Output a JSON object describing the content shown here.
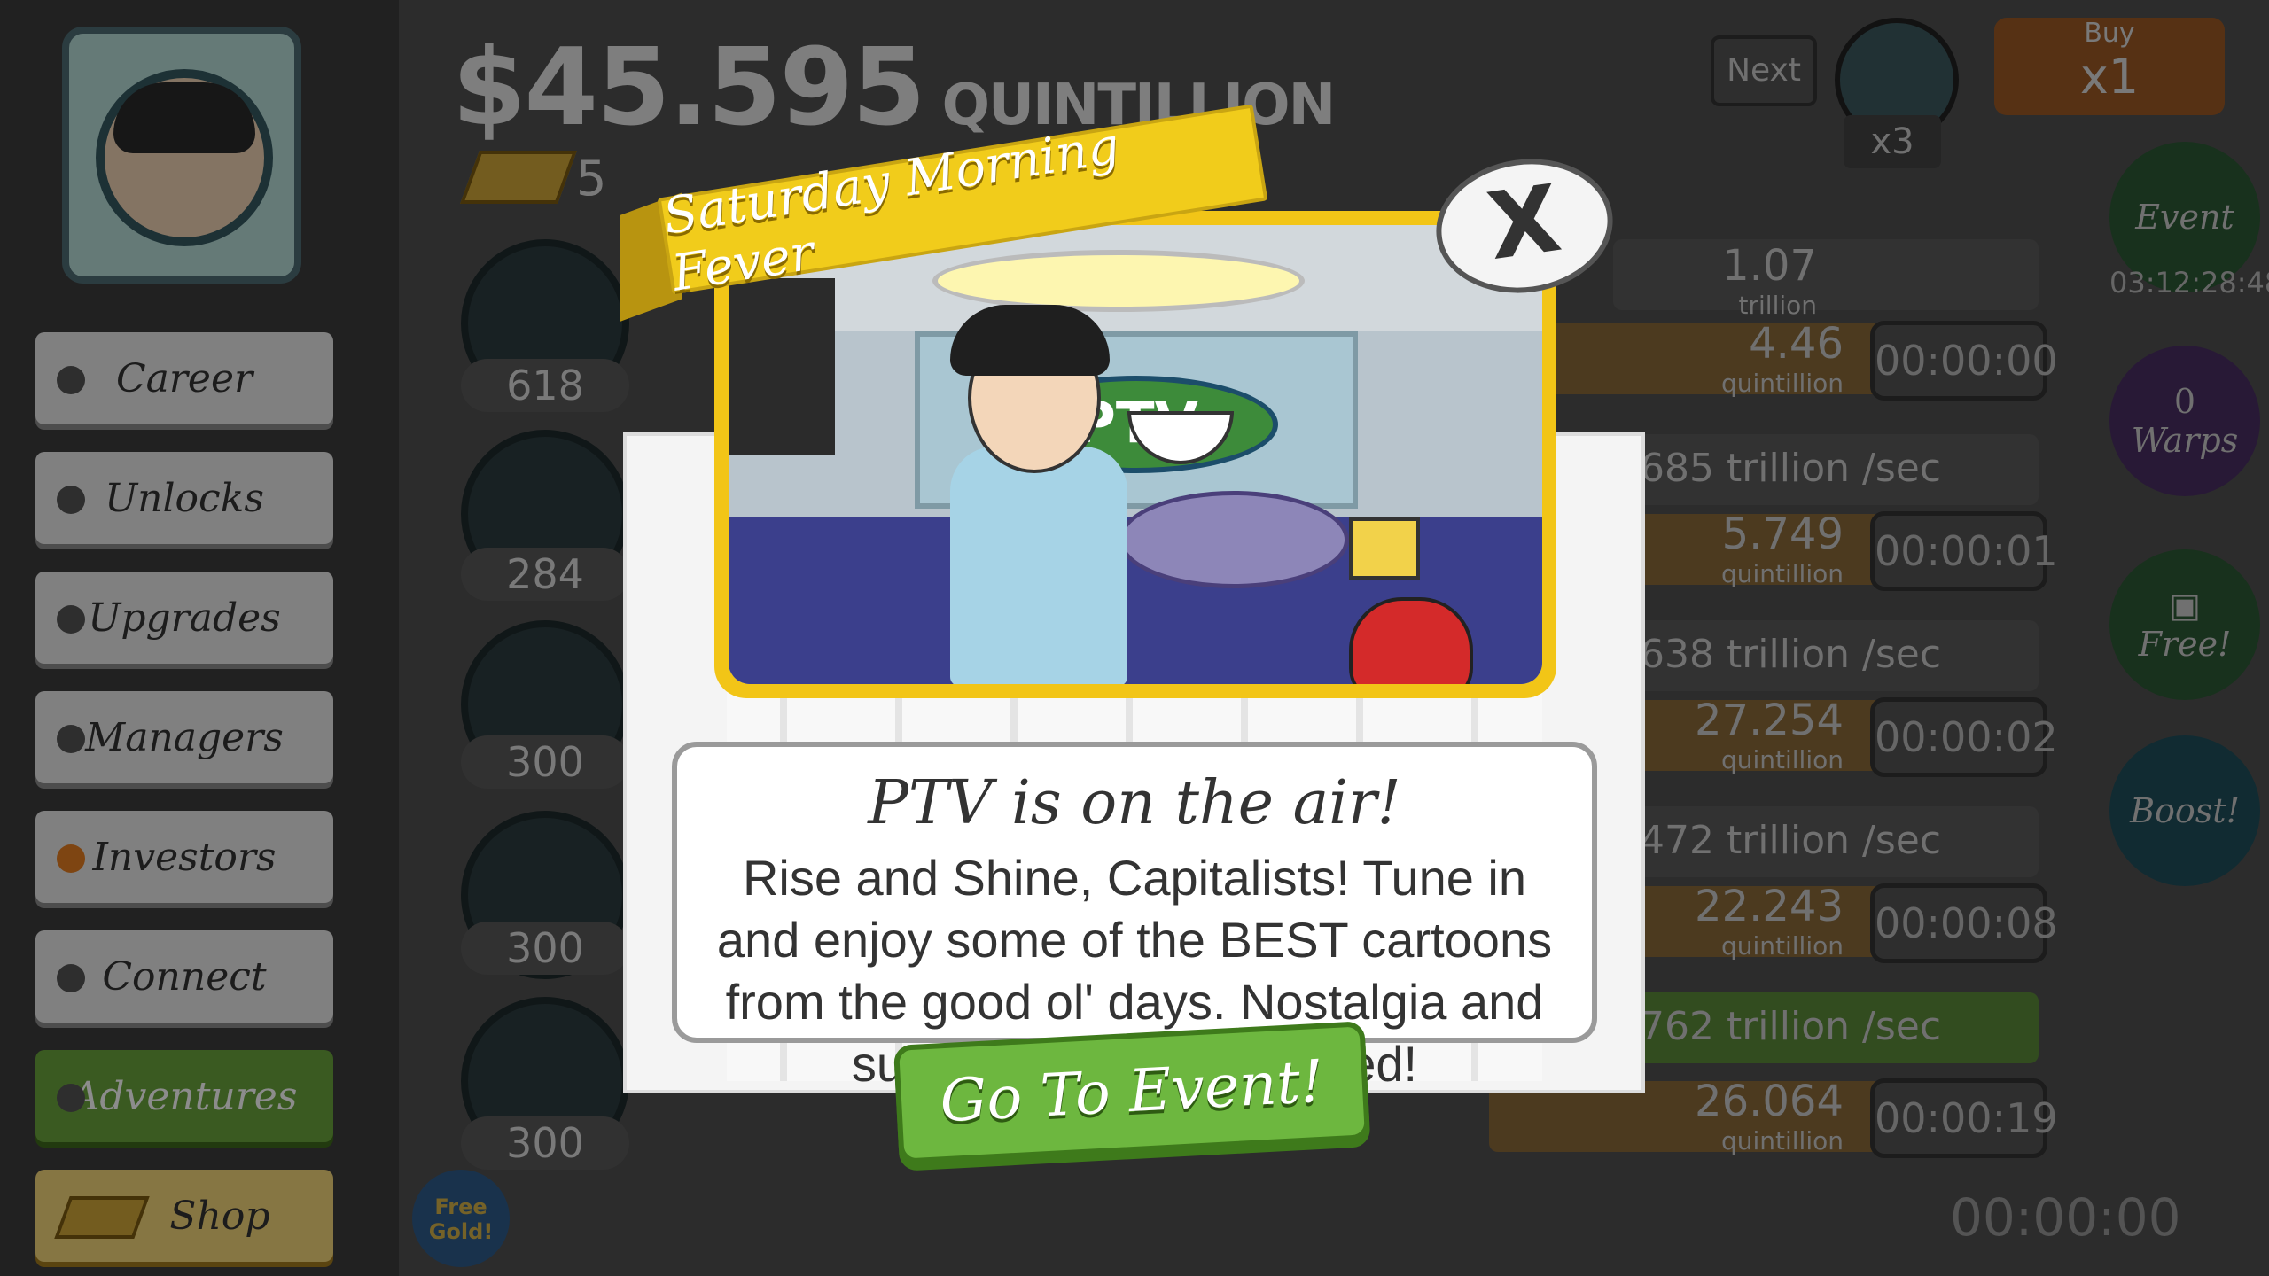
{
  "header": {
    "money_symbol": "$",
    "money_amount": "45.595",
    "money_unit": "QUINTILLION",
    "gold_count": "5",
    "next_label": "Next",
    "multiplier": "x3",
    "buy_label": "Buy",
    "buy_amount": "x1"
  },
  "sidebar": {
    "items": [
      {
        "label": "Career"
      },
      {
        "label": "Unlocks"
      },
      {
        "label": "Upgrades"
      },
      {
        "label": "Managers"
      },
      {
        "label": "Investors"
      },
      {
        "label": "Connect"
      },
      {
        "label": "Adventures"
      },
      {
        "label": "Shop"
      }
    ],
    "free_gold": "Free Gold!"
  },
  "businesses": [
    {
      "count": "618",
      "rate": "1.07",
      "rate_unit": "trillion",
      "value": "4.46",
      "value_unit": "quintillion",
      "timer": "00:00:00"
    },
    {
      "count": "284",
      "rate": "685 trillion /sec",
      "value": "5.749",
      "value_unit": "quintillion",
      "timer": "00:00:01"
    },
    {
      "count": "300",
      "rate": "638 trillion /sec",
      "value": "27.254",
      "value_unit": "quintillion",
      "timer": "00:00:02"
    },
    {
      "count": "300",
      "rate": "472 trillion /sec",
      "value": "22.243",
      "value_unit": "quintillion",
      "timer": "00:00:08"
    },
    {
      "count": "300",
      "rate": "762 trillion /sec",
      "value": "26.064",
      "value_unit": "quintillion",
      "timer": "00:00:19"
    }
  ],
  "right_panel": {
    "event_label": "Event",
    "event_time": "03:12:28:48",
    "warps_count": "0",
    "warps_label": "Warps",
    "free_label": "Free!",
    "boost_label": "Boost!",
    "bottom_timer": "00:00:00"
  },
  "modal": {
    "ribbon_title": "Saturday Morning Fever",
    "close_label": "X",
    "scene_sign": "PTV",
    "heading": "PTV is on the air!",
    "body": "Rise and Shine, Capitalists! Tune in and enjoy some of the BEST cartoons from the good ol' days. Nostalgia and sugar rushes guaranteed!",
    "cta_label": "Go To Event!"
  },
  "colors": {
    "ribbon": "#f1cc1b",
    "frame": "#f2c517",
    "cta": "#6db73f"
  }
}
